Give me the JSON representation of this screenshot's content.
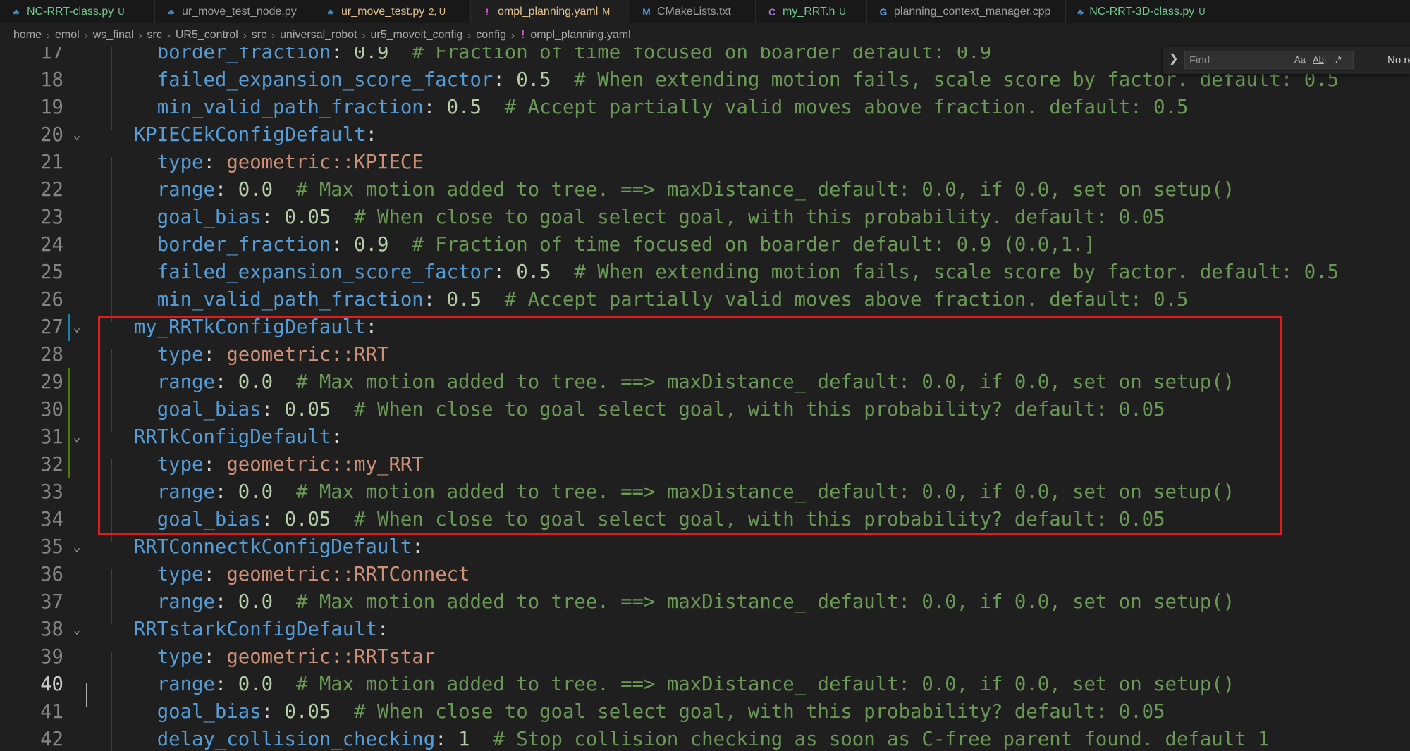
{
  "tabs": [
    {
      "label": "NC-RRT-class.py",
      "badge": "U",
      "icon": "python-icon",
      "status": "untracked",
      "active": false
    },
    {
      "label": "ur_move_test_node.py",
      "badge": "",
      "icon": "python-icon",
      "status": "normal",
      "active": false
    },
    {
      "label": "ur_move_test.py",
      "badge": "2, U",
      "icon": "python-icon",
      "status": "warning",
      "active": false
    },
    {
      "label": "ompl_planning.yaml",
      "badge": "M",
      "icon": "yaml-icon",
      "status": "modified",
      "active": true
    },
    {
      "label": "CMakeLists.txt",
      "badge": "",
      "icon": "cmake-icon",
      "status": "normal",
      "active": false
    },
    {
      "label": "my_RRT.h",
      "badge": "U",
      "icon": "c-header-icon",
      "status": "untracked",
      "active": false
    },
    {
      "label": "planning_context_manager.cpp",
      "badge": "",
      "icon": "cpp-icon",
      "status": "normal",
      "active": false
    },
    {
      "label": "NC-RRT-3D-class.py",
      "badge": "U",
      "icon": "python-icon",
      "status": "untracked",
      "active": false
    }
  ],
  "breadcrumb": [
    "home",
    "emol",
    "ws_final",
    "src",
    "UR5_control",
    "src",
    "universal_robot",
    "ur5_moveit_config",
    "config",
    "ompl_planning.yaml"
  ],
  "find": {
    "placeholder": "Find",
    "value": "",
    "case_label": "Aa",
    "word_label": "Ab|",
    "regex_label": ".*",
    "result": "No re"
  },
  "editor": {
    "current_line": 40,
    "lines": [
      {
        "num": "17",
        "fold": false,
        "git": "",
        "tokens": [
          {
            "t": "    ",
            "c": "p"
          },
          {
            "t": "border_fraction",
            "c": "k"
          },
          {
            "t": ": ",
            "c": "p"
          },
          {
            "t": "0.9",
            "c": "n"
          },
          {
            "t": "  # Fraction of time focused on boarder default: 0.9",
            "c": "c"
          }
        ]
      },
      {
        "num": "18",
        "fold": false,
        "git": "",
        "tokens": [
          {
            "t": "    ",
            "c": "p"
          },
          {
            "t": "failed_expansion_score_factor",
            "c": "k"
          },
          {
            "t": ": ",
            "c": "p"
          },
          {
            "t": "0.5",
            "c": "n"
          },
          {
            "t": "  # When extending motion fails, scale score by factor. default: 0.5",
            "c": "c"
          }
        ]
      },
      {
        "num": "19",
        "fold": false,
        "git": "",
        "tokens": [
          {
            "t": "    ",
            "c": "p"
          },
          {
            "t": "min_valid_path_fraction",
            "c": "k"
          },
          {
            "t": ": ",
            "c": "p"
          },
          {
            "t": "0.5",
            "c": "n"
          },
          {
            "t": "  # Accept partially valid moves above fraction. default: 0.5",
            "c": "c"
          }
        ]
      },
      {
        "num": "20",
        "fold": true,
        "git": "",
        "tokens": [
          {
            "t": "  ",
            "c": "p"
          },
          {
            "t": "KPIECEkConfigDefault",
            "c": "k"
          },
          {
            "t": ":",
            "c": "p"
          }
        ]
      },
      {
        "num": "21",
        "fold": false,
        "git": "",
        "tokens": [
          {
            "t": "    ",
            "c": "p"
          },
          {
            "t": "type",
            "c": "k"
          },
          {
            "t": ": ",
            "c": "p"
          },
          {
            "t": "geometric::KPIECE",
            "c": "s"
          }
        ]
      },
      {
        "num": "22",
        "fold": false,
        "git": "",
        "tokens": [
          {
            "t": "    ",
            "c": "p"
          },
          {
            "t": "range",
            "c": "k"
          },
          {
            "t": ": ",
            "c": "p"
          },
          {
            "t": "0.0",
            "c": "n"
          },
          {
            "t": "  # Max motion added to tree. ==> maxDistance_ default: 0.0, if 0.0, set on setup()",
            "c": "c"
          }
        ]
      },
      {
        "num": "23",
        "fold": false,
        "git": "",
        "tokens": [
          {
            "t": "    ",
            "c": "p"
          },
          {
            "t": "goal_bias",
            "c": "k"
          },
          {
            "t": ": ",
            "c": "p"
          },
          {
            "t": "0.05",
            "c": "n"
          },
          {
            "t": "  # When close to goal select goal, with this probability. default: 0.05",
            "c": "c"
          }
        ]
      },
      {
        "num": "24",
        "fold": false,
        "git": "",
        "tokens": [
          {
            "t": "    ",
            "c": "p"
          },
          {
            "t": "border_fraction",
            "c": "k"
          },
          {
            "t": ": ",
            "c": "p"
          },
          {
            "t": "0.9",
            "c": "n"
          },
          {
            "t": "  # Fraction of time focused on boarder default: 0.9 (0.0,1.]",
            "c": "c"
          }
        ]
      },
      {
        "num": "25",
        "fold": false,
        "git": "",
        "tokens": [
          {
            "t": "    ",
            "c": "p"
          },
          {
            "t": "failed_expansion_score_factor",
            "c": "k"
          },
          {
            "t": ": ",
            "c": "p"
          },
          {
            "t": "0.5",
            "c": "n"
          },
          {
            "t": "  # When extending motion fails, scale score by factor. default: 0.5",
            "c": "c"
          }
        ]
      },
      {
        "num": "26",
        "fold": false,
        "git": "",
        "tokens": [
          {
            "t": "    ",
            "c": "p"
          },
          {
            "t": "min_valid_path_fraction",
            "c": "k"
          },
          {
            "t": ": ",
            "c": "p"
          },
          {
            "t": "0.5",
            "c": "n"
          },
          {
            "t": "  # Accept partially valid moves above fraction. default: 0.5",
            "c": "c"
          }
        ]
      },
      {
        "num": "27",
        "fold": true,
        "git": "#1b81a8",
        "tokens": [
          {
            "t": "  ",
            "c": "p"
          },
          {
            "t": "my_RRTkConfigDefault",
            "c": "k"
          },
          {
            "t": ":",
            "c": "p"
          }
        ]
      },
      {
        "num": "28",
        "fold": false,
        "git": "",
        "tokens": [
          {
            "t": "    ",
            "c": "p"
          },
          {
            "t": "type",
            "c": "k"
          },
          {
            "t": ": ",
            "c": "p"
          },
          {
            "t": "geometric::RRT",
            "c": "s"
          }
        ]
      },
      {
        "num": "29",
        "fold": false,
        "git": "#487e02",
        "tokens": [
          {
            "t": "    ",
            "c": "p"
          },
          {
            "t": "range",
            "c": "k"
          },
          {
            "t": ": ",
            "c": "p"
          },
          {
            "t": "0.0",
            "c": "n"
          },
          {
            "t": "  # Max motion added to tree. ==> maxDistance_ default: 0.0, if 0.0, set on setup()",
            "c": "c"
          }
        ]
      },
      {
        "num": "30",
        "fold": false,
        "git": "#487e02",
        "tokens": [
          {
            "t": "    ",
            "c": "p"
          },
          {
            "t": "goal_bias",
            "c": "k"
          },
          {
            "t": ": ",
            "c": "p"
          },
          {
            "t": "0.05",
            "c": "n"
          },
          {
            "t": "  # When close to goal select goal, with this probability? default: 0.05",
            "c": "c"
          }
        ]
      },
      {
        "num": "31",
        "fold": true,
        "git": "#487e02",
        "tokens": [
          {
            "t": "  ",
            "c": "p"
          },
          {
            "t": "RRTkConfigDefault",
            "c": "k"
          },
          {
            "t": ":",
            "c": "p"
          }
        ]
      },
      {
        "num": "32",
        "fold": false,
        "git": "#487e02",
        "tokens": [
          {
            "t": "    ",
            "c": "p"
          },
          {
            "t": "type",
            "c": "k"
          },
          {
            "t": ": ",
            "c": "p"
          },
          {
            "t": "geometric::my_RRT",
            "c": "s"
          }
        ]
      },
      {
        "num": "33",
        "fold": false,
        "git": "",
        "tokens": [
          {
            "t": "    ",
            "c": "p"
          },
          {
            "t": "range",
            "c": "k"
          },
          {
            "t": ": ",
            "c": "p"
          },
          {
            "t": "0.0",
            "c": "n"
          },
          {
            "t": "  # Max motion added to tree. ==> maxDistance_ default: 0.0, if 0.0, set on setup()",
            "c": "c"
          }
        ]
      },
      {
        "num": "34",
        "fold": false,
        "git": "",
        "tokens": [
          {
            "t": "    ",
            "c": "p"
          },
          {
            "t": "goal_bias",
            "c": "k"
          },
          {
            "t": ": ",
            "c": "p"
          },
          {
            "t": "0.05",
            "c": "n"
          },
          {
            "t": "  # When close to goal select goal, with this probability? default: 0.05",
            "c": "c"
          }
        ]
      },
      {
        "num": "35",
        "fold": true,
        "git": "",
        "tokens": [
          {
            "t": "  ",
            "c": "p"
          },
          {
            "t": "RRTConnectkConfigDefault",
            "c": "k"
          },
          {
            "t": ":",
            "c": "p"
          }
        ]
      },
      {
        "num": "36",
        "fold": false,
        "git": "",
        "tokens": [
          {
            "t": "    ",
            "c": "p"
          },
          {
            "t": "type",
            "c": "k"
          },
          {
            "t": ": ",
            "c": "p"
          },
          {
            "t": "geometric::RRTConnect",
            "c": "s"
          }
        ]
      },
      {
        "num": "37",
        "fold": false,
        "git": "",
        "tokens": [
          {
            "t": "    ",
            "c": "p"
          },
          {
            "t": "range",
            "c": "k"
          },
          {
            "t": ": ",
            "c": "p"
          },
          {
            "t": "0.0",
            "c": "n"
          },
          {
            "t": "  # Max motion added to tree. ==> maxDistance_ default: 0.0, if 0.0, set on setup()",
            "c": "c"
          }
        ]
      },
      {
        "num": "38",
        "fold": true,
        "git": "",
        "tokens": [
          {
            "t": "  ",
            "c": "p"
          },
          {
            "t": "RRTstarkConfigDefault",
            "c": "k"
          },
          {
            "t": ":",
            "c": "p"
          }
        ]
      },
      {
        "num": "39",
        "fold": false,
        "git": "",
        "tokens": [
          {
            "t": "    ",
            "c": "p"
          },
          {
            "t": "type",
            "c": "k"
          },
          {
            "t": ": ",
            "c": "p"
          },
          {
            "t": "geometric::RRTstar",
            "c": "s"
          }
        ]
      },
      {
        "num": "40",
        "fold": false,
        "git": "",
        "tokens": [
          {
            "t": "    ",
            "c": "p"
          },
          {
            "t": "range",
            "c": "k"
          },
          {
            "t": ": ",
            "c": "p"
          },
          {
            "t": "0.0",
            "c": "n"
          },
          {
            "t": "  # Max motion added to tree. ==> maxDistance_ default: 0.0, if 0.0, set on setup()",
            "c": "c"
          }
        ]
      },
      {
        "num": "41",
        "fold": false,
        "git": "",
        "tokens": [
          {
            "t": "    ",
            "c": "p"
          },
          {
            "t": "goal_bias",
            "c": "k"
          },
          {
            "t": ": ",
            "c": "p"
          },
          {
            "t": "0.05",
            "c": "n"
          },
          {
            "t": "  # When close to goal select goal, with this probability? default: 0.05",
            "c": "c"
          }
        ]
      },
      {
        "num": "42",
        "fold": false,
        "git": "",
        "tokens": [
          {
            "t": "    ",
            "c": "p"
          },
          {
            "t": "delay_collision_checking",
            "c": "k"
          },
          {
            "t": ": ",
            "c": "p"
          },
          {
            "t": "1",
            "c": "n"
          },
          {
            "t": "  # Stop collision checking as soon as C-free parent found. default 1",
            "c": "c"
          }
        ]
      }
    ]
  },
  "colors": {
    "keyword": "#569cd6",
    "number": "#b5cea8",
    "string": "#ce9178",
    "comment": "#6a9955",
    "highlight_box": "#e31b1b"
  }
}
